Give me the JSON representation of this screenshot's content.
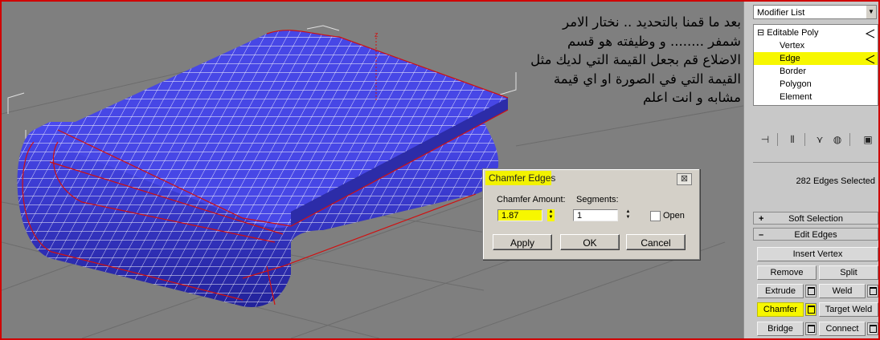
{
  "annotation": {
    "lines": [
      "بعد ما قمنا بالتحديد .. نختار الامر",
      "شمفر ........ و وظيفته هو قسم",
      "الاضلاع قم بجعل القيمة التي لديك مثل",
      "القيمة التي في الصورة او اي قيمة",
      "مشابه و انت اعلم"
    ]
  },
  "viewport": {
    "axis_label": "z"
  },
  "dialog": {
    "title": "Chamfer Edges",
    "close_glyph": "⊠",
    "chamfer_amount_label": "Chamfer Amount:",
    "chamfer_amount_value": "1.87",
    "segments_label": "Segments:",
    "segments_value": "1",
    "open_label": "Open",
    "apply_label": "Apply",
    "ok_label": "OK",
    "cancel_label": "Cancel"
  },
  "command_panel": {
    "modifier_list_label": "Modifier List",
    "stack": {
      "root": "Editable Poly",
      "root_toggle": "⊟",
      "items": [
        "Vertex",
        "Edge",
        "Border",
        "Polygon",
        "Element"
      ],
      "selected_item": "Edge"
    },
    "selection_info": "282 Edges Selected",
    "rollouts": {
      "soft_selection": "Soft Selection",
      "soft_selection_toggle": "+",
      "edit_edges": "Edit Edges",
      "edit_edges_toggle": "–"
    },
    "buttons": {
      "insert_vertex": "Insert Vertex",
      "remove": "Remove",
      "split": "Split",
      "extrude": "Extrude",
      "weld": "Weld",
      "chamfer": "Chamfer",
      "target_weld": "Target Weld",
      "bridge": "Bridge",
      "connect": "Connect"
    }
  },
  "colors": {
    "highlight": "#f7f700",
    "mesh_fill": "#3b3bd6",
    "wire": "#ffffff",
    "selected_edges": "#d01010",
    "viewport_bg": "#7f7f7f"
  }
}
